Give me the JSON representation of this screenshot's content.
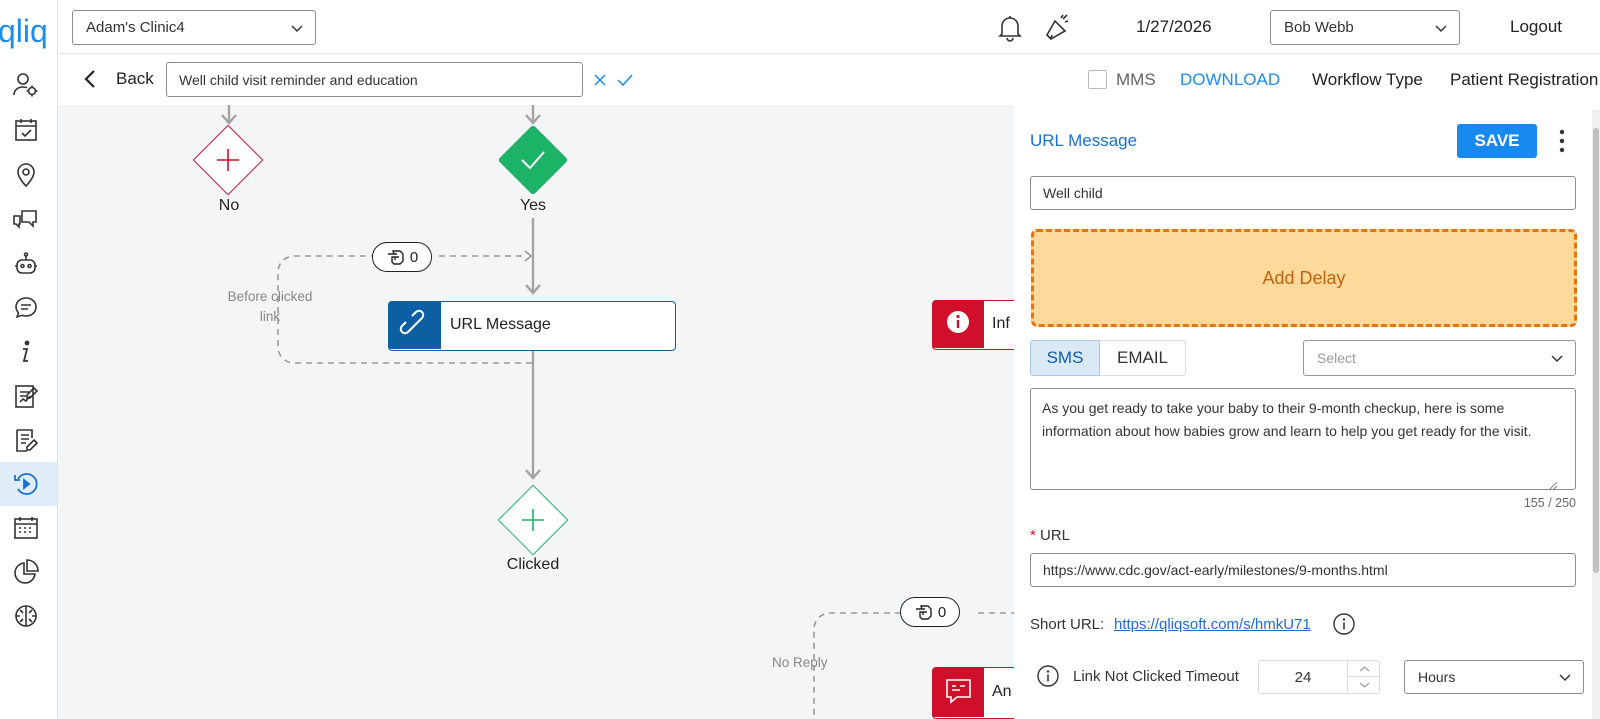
{
  "header": {
    "clinic": "Adam's Clinic4",
    "date": "1/27/2026",
    "user": "Bob Webb",
    "logout_label": "Logout"
  },
  "toolbar": {
    "back_label": "Back",
    "workflow_name": "Well child visit reminder and education",
    "mms_label": "MMS",
    "download_label": "DOWNLOAD",
    "workflow_type_label": "Workflow Type",
    "workflow_type_value": "Patient Registration"
  },
  "canvas": {
    "nodes": {
      "no_label": "No",
      "yes_label": "Yes",
      "clicked_label": "Clicked",
      "url_message_label": "URL Message",
      "info_partial_label": "Inf",
      "an_partial_label": "An"
    },
    "counters": {
      "click_count_1": "0",
      "click_count_2": "0"
    },
    "edge_labels": {
      "before_clicked_line1": "Before clicked",
      "before_clicked_line2": "link",
      "no_reply": "No Reply"
    }
  },
  "panel": {
    "title": "URL Message",
    "save_label": "SAVE",
    "name_value": "Well child",
    "add_delay_label": "Add Delay",
    "tabs": [
      "SMS",
      "EMAIL"
    ],
    "select_placeholder": "Select",
    "message_text": "As you get ready to take your baby to their 9-month checkup, here is some information about how babies grow and learn to help you get ready for the visit.",
    "char_count": "155 / 250",
    "url_required_marker": "*",
    "url_label": "URL",
    "url_value": "https://www.cdc.gov/act-early/milestones/9-months.html",
    "short_url_label": "Short URL:",
    "short_url_value": "https://qliqsoft.com/s/hmkU71",
    "timeout_label": "Link Not Clicked Timeout",
    "timeout_value": "24",
    "timeout_unit": "Hours"
  },
  "brand": {
    "logo_text": "qliq"
  },
  "colors": {
    "accent_blue": "#1a8ef0",
    "save_blue": "#1889ee",
    "link_blue": "#1a6fd1",
    "no_red": "#d0102a",
    "yes_green": "#1db366",
    "url_node_blue": "#0d5fa3",
    "delay_orange": "#e8740e",
    "delay_fill": "#fdd99c"
  }
}
